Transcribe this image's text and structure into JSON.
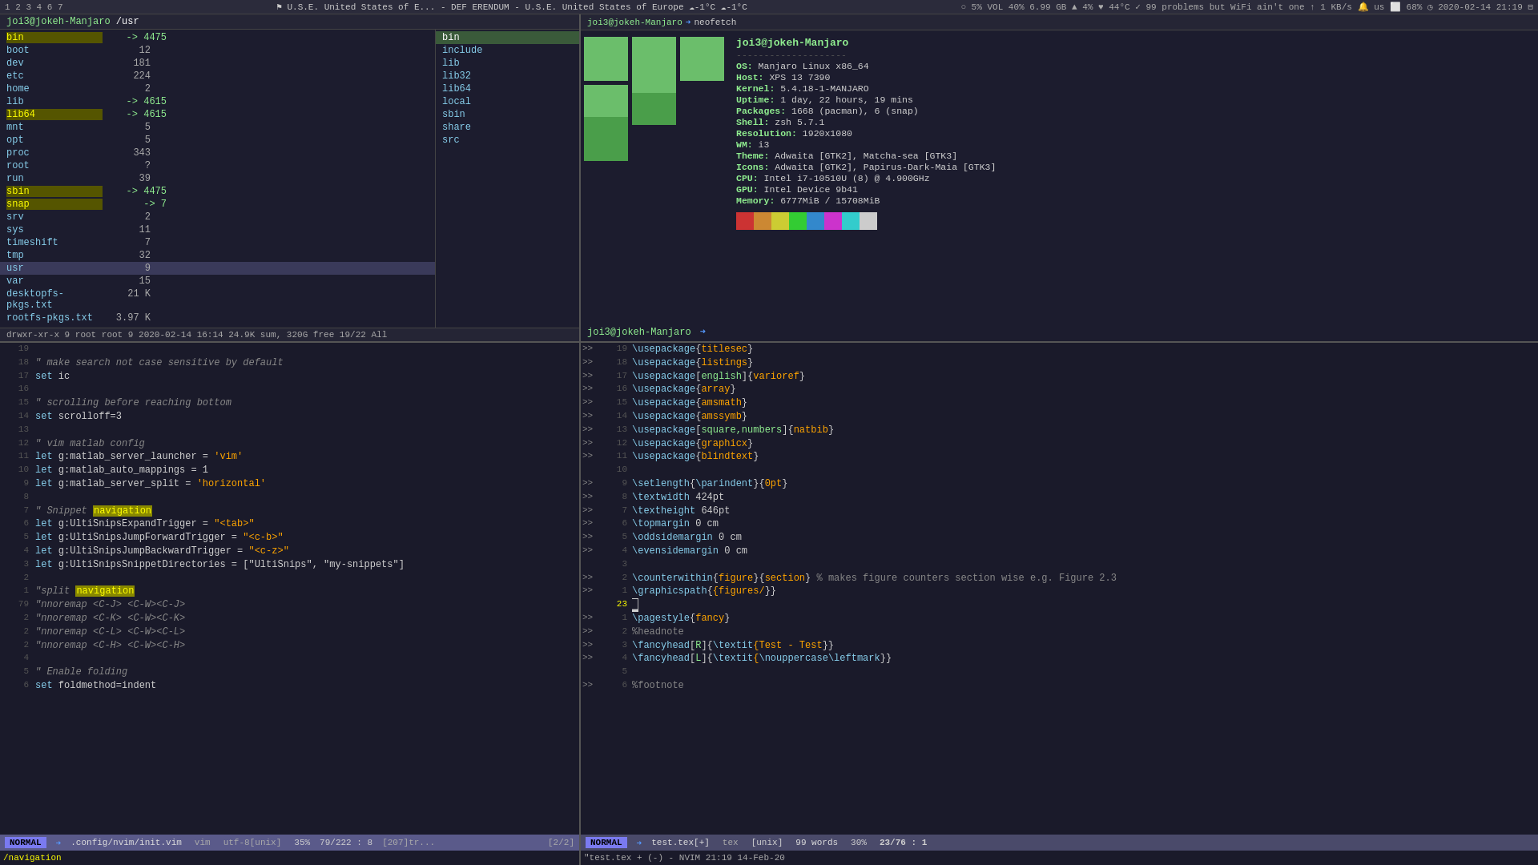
{
  "topbar": {
    "workspaces": "1 2 3 4 6 7",
    "center": "⚑ U.S.E. United States of E... - DEF ERENDUM - U.S.E. United States of Europe ☁-1°C ☁-1°C",
    "right": "○ 5%  VOL 40%  6.99 GB  ▲ 4%  ♥ 44°C  ✓ 99 problems but WiFi ain't one  ↑ 1 KB/s  🔔 us  ⬜ 68%  ◷ 2020-02-14 21:19  ⊟"
  },
  "file_pane": {
    "header_user": "joi3@jokeh-Manjaro",
    "header_path": "/usr",
    "files": [
      {
        "name": "bin",
        "arrow": "-> 4475",
        "highlight": "yellow"
      },
      {
        "name": "boot",
        "size": "12"
      },
      {
        "name": "dev",
        "size": "181"
      },
      {
        "name": "etc",
        "size": "224"
      },
      {
        "name": "home",
        "size": "2"
      },
      {
        "name": "lib",
        "arrow": "-> 4615"
      },
      {
        "name": "lib64",
        "arrow": "-> 4615",
        "highlight": "yellow"
      },
      {
        "name": "mnt",
        "size": "5"
      },
      {
        "name": "opt",
        "size": "5"
      },
      {
        "name": "proc",
        "size": "343"
      },
      {
        "name": "root",
        "size": "?"
      },
      {
        "name": "run",
        "size": "39"
      },
      {
        "name": "sbin",
        "arrow": "-> 4475",
        "highlight": "yellow"
      },
      {
        "name": "snap",
        "arrow": "-> 7",
        "highlight": "yellow"
      },
      {
        "name": "srv",
        "size": "2"
      },
      {
        "name": "sys",
        "size": "11"
      },
      {
        "name": "timeshift",
        "size": "7"
      },
      {
        "name": "tmp",
        "size": "32"
      },
      {
        "name": "usr",
        "size": "9",
        "selected": true
      },
      {
        "name": "var",
        "size": "15"
      },
      {
        "name": "desktopfs-pkgs.txt",
        "size": "21 K"
      },
      {
        "name": "rootfs-pkgs.txt",
        "size": "3.97 K"
      }
    ],
    "right_panel": [
      "bin",
      "include",
      "lib",
      "lib32",
      "lib64",
      "local",
      "sbin",
      "share",
      "src"
    ],
    "status": "drwxr-xr-x 9 root root 9 2020-02-14 16:14     24.9K sum, 320G free  19/22   All"
  },
  "neo": {
    "user": "joi3@jokeh-Manjaro",
    "cmd": "neofetch",
    "userhost": "joi3@jokeh-Manjaro",
    "separator": "--------------------",
    "os": "Manjaro Linux x86_64",
    "host": "XPS 13 7390",
    "kernel": "5.4.18-1-MANJARO",
    "uptime": "1 day, 22 hours, 19 mins",
    "packages": "1668 (pacman), 6 (snap)",
    "shell": "zsh 5.7.1",
    "resolution": "1920x1080",
    "wm": "i3",
    "theme": "Adwaita [GTK2], Matcha-sea [GTK3]",
    "icons": "Adwaita [GTK2], Papirus-Dark-Maia [GTK3]",
    "cpu": "Intel i7-10510U (8) @ 4.900GHz",
    "gpu": "Intel Device 9b41",
    "memory": "6777MiB / 15708MiB",
    "colors": [
      "#cc3333",
      "#cc8833",
      "#cccc33",
      "#33cc33",
      "#3388cc",
      "#cc33cc",
      "#33cccc",
      "#cccccc"
    ],
    "prompt_user": "joi3@jokeh-Manjaro",
    "prompt_arrow": "➜"
  },
  "vim_left": {
    "lines": [
      {
        "num": "19",
        "content": ""
      },
      {
        "num": "18",
        "text": "\" make search not case sensitive by default",
        "type": "comment"
      },
      {
        "num": "17",
        "text": "set ic",
        "type": "set"
      },
      {
        "num": "16",
        "text": ""
      },
      {
        "num": "15",
        "text": "\" scrolling before reaching bottom",
        "type": "comment"
      },
      {
        "num": "14",
        "text": "set scrolloff=3",
        "type": "set"
      },
      {
        "num": "13",
        "text": ""
      },
      {
        "num": "12",
        "text": "\" vim matlab config",
        "type": "comment"
      },
      {
        "num": "11",
        "text": "let g:matlab_server_launcher = 'vim'",
        "type": "let"
      },
      {
        "num": "10",
        "text": "let g:matlab_auto_mappings = 1",
        "type": "let"
      },
      {
        "num": "9",
        "text": "let g:matlab_server_split = 'horizontal'",
        "type": "let"
      },
      {
        "num": "8",
        "text": ""
      },
      {
        "num": "7",
        "text": "\" Snippet navigation",
        "type": "snippet"
      },
      {
        "num": "6",
        "text": "let g:UltiSnipsExpandTrigger=\"<tab>\"",
        "type": "let"
      },
      {
        "num": "5",
        "text": "let g:UltiSnipsJumpForwardTrigger=\"<c-b>\"",
        "type": "let"
      },
      {
        "num": "4",
        "text": "let g:UltiSnipsJumpBackwardTrigger=\"<c-z>\"",
        "type": "let"
      },
      {
        "num": "3",
        "text": "let g:UltiSnipsSnippetDirectories=[\"UltiSnips\", \"my-snippets\"]",
        "type": "let"
      },
      {
        "num": "2",
        "text": ""
      },
      {
        "num": "1",
        "text": "\"split navigation",
        "type": "splitnav"
      },
      {
        "num": "79",
        "text": "\"nnoremap <C-J> <C-W><C-J>",
        "type": "map"
      },
      {
        "num": "2",
        "text": "\"nnoremap <C-K> <C-W><C-K>",
        "type": "map"
      },
      {
        "num": "2",
        "text": "\"nnoremap <C-L> <C-W><C-L>",
        "type": "map"
      },
      {
        "num": "2",
        "text": "\"nnoremap <C-H> <C-W><C-H>",
        "type": "map"
      },
      {
        "num": "4",
        "text": ""
      },
      {
        "num": "5",
        "text": "\" Enable folding",
        "type": "comment"
      },
      {
        "num": "6",
        "text": "set foldmethod=indent",
        "type": "set"
      }
    ],
    "statusbar": {
      "mode": "NORMAL",
      "file": ".config/nvim/init.vim",
      "type": "vim",
      "encoding": "utf-8[unix]",
      "percent": "35%",
      "pos": "79/222 : 8",
      "extra": "[207]tr..."
    },
    "cmdline": "/navigation",
    "tabline": "[2/2]"
  },
  "vim_right": {
    "lines": [
      {
        "marker": ">>",
        "num": "19",
        "text": "\\usepackage{titlesec}"
      },
      {
        "marker": ">>",
        "num": "18",
        "text": "\\usepackage{listings}"
      },
      {
        "marker": ">>",
        "num": "17",
        "text": "\\usepackage[english]{varioref}"
      },
      {
        "marker": ">>",
        "num": "16",
        "text": "\\usepackage{array}"
      },
      {
        "marker": ">>",
        "num": "15",
        "text": "\\usepackage{amsmath}"
      },
      {
        "marker": ">>",
        "num": "14",
        "text": "\\usepackage{amssymb}"
      },
      {
        "marker": ">>",
        "num": "13",
        "text": "\\usepackage[square,numbers]{natbib}"
      },
      {
        "marker": ">>",
        "num": "12",
        "text": "\\usepackage{graphicx}"
      },
      {
        "marker": ">>",
        "num": "11",
        "text": "\\usepackage{blindtext}"
      },
      {
        "marker": "",
        "num": "10",
        "text": ""
      },
      {
        "marker": ">>",
        "num": "9",
        "text": "\\setlength{\\parindent}{0pt}"
      },
      {
        "marker": ">>",
        "num": "8",
        "text": "\\textwidth 424pt"
      },
      {
        "marker": ">>",
        "num": "7",
        "text": "\\textheight 646pt"
      },
      {
        "marker": ">>",
        "num": "6",
        "text": "\\topmargin 0 cm"
      },
      {
        "marker": ">>",
        "num": "5",
        "text": "\\oddsidemargin 0 cm"
      },
      {
        "marker": ">>",
        "num": "4",
        "text": "\\evensidemargin 0 cm"
      },
      {
        "marker": "",
        "num": "3",
        "text": ""
      },
      {
        "marker": ">>",
        "num": "2",
        "text": "\\counterwithin{figure}{section} % makes figure counters section wise e.g. Figure 2.3"
      },
      {
        "marker": ">>",
        "num": "1",
        "text": "\\graphicspath{{figures/}}"
      },
      {
        "marker": "",
        "num": "23",
        "text": "█",
        "cursor": true
      },
      {
        "marker": ">>",
        "num": "1",
        "text": "\\pagestyle{fancy}"
      },
      {
        "marker": ">>",
        "num": "2",
        "text": "%headnote"
      },
      {
        "marker": ">>",
        "num": "3",
        "text": "\\fancyhead[R]{\\textit{Test - Test}}"
      },
      {
        "marker": ">>",
        "num": "4",
        "text": "\\fancyhead[L]{\\textit{\\nouppercase\\leftmark}}"
      },
      {
        "marker": "",
        "num": "5",
        "text": ""
      },
      {
        "marker": ">>",
        "num": "6",
        "text": "%footnote"
      }
    ],
    "statusbar": {
      "mode": "NORMAL",
      "file": "test.tex[+]",
      "type": "tex",
      "encoding": "[unix]",
      "words": "99 words",
      "percent": "30%",
      "pos": "23/76 : 1"
    },
    "cmdline": "\"test.tex + (-) - NVIM  21:19  14-Feb-20"
  }
}
